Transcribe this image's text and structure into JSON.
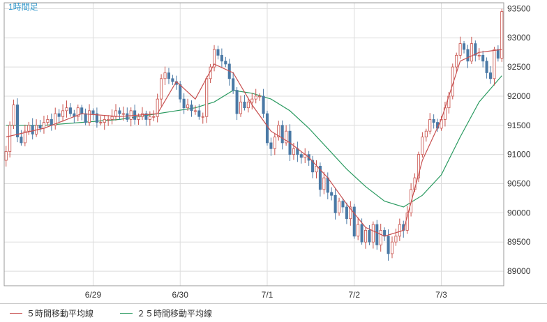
{
  "timeframe_label": "1時間足",
  "legend": {
    "ma5_label": "５時間移動平均線",
    "ma25_label": "２５時間移動平均線"
  },
  "colors": {
    "up": "#c8504a",
    "down": "#4a79a5",
    "ma5": "#c85050",
    "ma25": "#2a9a60",
    "grid": "#dcdcdc",
    "frame": "#999999",
    "label": "#3399cc"
  },
  "chart_data": {
    "type": "candlestick",
    "y_ticks": [
      89000,
      89500,
      90000,
      90500,
      91000,
      91500,
      92000,
      92500,
      93000,
      93500
    ],
    "ylim": [
      88750,
      93600
    ],
    "x_ticks": [
      {
        "label": "6/29",
        "index": 23
      },
      {
        "label": "6/30",
        "index": 46
      },
      {
        "label": "7/1",
        "index": 69
      },
      {
        "label": "7/2",
        "index": 92
      },
      {
        "label": "7/3",
        "index": 115
      }
    ],
    "x_count": 132,
    "closes": [
      91050,
      91500,
      91850,
      91300,
      91200,
      91400,
      91500,
      91350,
      91500,
      91450,
      91550,
      91600,
      91500,
      91700,
      91650,
      91750,
      91800,
      91700,
      91650,
      91800,
      91700,
      91550,
      91750,
      91700,
      91550,
      91550,
      91600,
      91600,
      91650,
      91750,
      91700,
      91700,
      91600,
      91750,
      91600,
      91650,
      91700,
      91600,
      91650,
      91650,
      91950,
      92300,
      92400,
      92300,
      92250,
      92200,
      91950,
      91800,
      91850,
      91750,
      91750,
      91650,
      91650,
      92300,
      92500,
      92800,
      92700,
      92600,
      92550,
      92300,
      92100,
      91700,
      91900,
      91800,
      91900,
      91950,
      92000,
      92000,
      91700,
      91200,
      91100,
      91300,
      91500,
      91200,
      91400,
      91000,
      91100,
      91000,
      90950,
      91000,
      90900,
      90700,
      90800,
      90400,
      90600,
      90350,
      90300,
      90000,
      90200,
      90100,
      89900,
      90100,
      89600,
      89800,
      89500,
      89700,
      89500,
      89800,
      89450,
      89700,
      89600,
      89300,
      89500,
      89600,
      89800,
      89700,
      90000,
      90400,
      90600,
      91000,
      91300,
      91400,
      91600,
      91550,
      91450,
      91600,
      91800,
      92000,
      92500,
      92700,
      92900,
      92800,
      92600,
      92900,
      92700,
      92700,
      92600,
      92400,
      92300,
      92800,
      92650,
      93450
    ],
    "ma5_sample": [
      [
        0,
        91300
      ],
      [
        10,
        91450
      ],
      [
        20,
        91700
      ],
      [
        30,
        91650
      ],
      [
        40,
        91700
      ],
      [
        45,
        92250
      ],
      [
        50,
        91950
      ],
      [
        55,
        92550
      ],
      [
        60,
        92400
      ],
      [
        65,
        91850
      ],
      [
        70,
        91400
      ],
      [
        75,
        91200
      ],
      [
        80,
        90950
      ],
      [
        85,
        90600
      ],
      [
        90,
        90150
      ],
      [
        95,
        89750
      ],
      [
        100,
        89600
      ],
      [
        105,
        89700
      ],
      [
        110,
        90900
      ],
      [
        115,
        91600
      ],
      [
        120,
        92600
      ],
      [
        125,
        92750
      ],
      [
        131,
        92800
      ]
    ],
    "ma25_sample": [
      [
        0,
        91500
      ],
      [
        10,
        91500
      ],
      [
        20,
        91550
      ],
      [
        30,
        91600
      ],
      [
        40,
        91700
      ],
      [
        50,
        91800
      ],
      [
        55,
        91900
      ],
      [
        60,
        92100
      ],
      [
        65,
        92050
      ],
      [
        70,
        91950
      ],
      [
        75,
        91750
      ],
      [
        80,
        91450
      ],
      [
        85,
        91100
      ],
      [
        90,
        90750
      ],
      [
        95,
        90450
      ],
      [
        100,
        90200
      ],
      [
        105,
        90100
      ],
      [
        110,
        90300
      ],
      [
        115,
        90650
      ],
      [
        120,
        91300
      ],
      [
        125,
        91900
      ],
      [
        131,
        92350
      ]
    ]
  }
}
